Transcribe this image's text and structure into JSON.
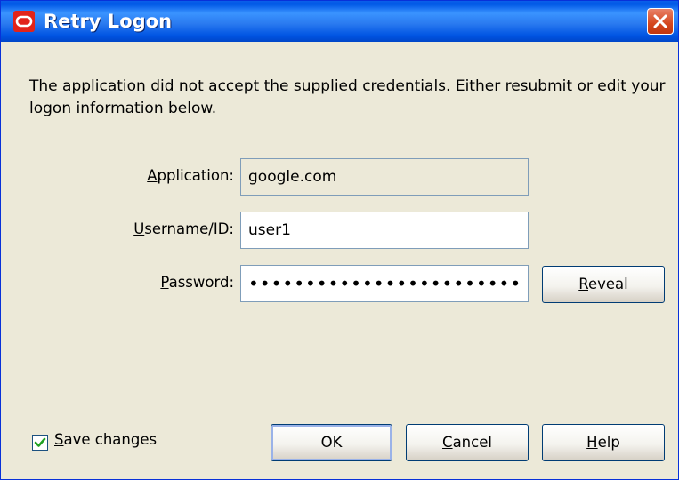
{
  "window": {
    "title": "Retry Logon"
  },
  "message": "The application did not accept the supplied credentials. Either resubmit or edit your logon information below.",
  "form": {
    "application": {
      "label_u": "A",
      "label_rest": "pplication:",
      "value": "google.com"
    },
    "username": {
      "label_u": "U",
      "label_rest": "sername/ID:",
      "value": "user1"
    },
    "password": {
      "label_u": "P",
      "label_rest": "assword:",
      "value": "••••••••••••••••••••••••"
    }
  },
  "buttons": {
    "reveal": {
      "u": "R",
      "rest": "eveal"
    },
    "ok": {
      "label": "OK"
    },
    "cancel": {
      "u": "C",
      "rest": "ancel"
    },
    "help": {
      "u": "H",
      "rest": "elp"
    }
  },
  "save_changes": {
    "u": "S",
    "rest": "ave changes",
    "checked": true
  },
  "colors": {
    "title_bar": "#0054E3",
    "dialog_bg": "#ECE9D8",
    "close_button": "#D5461D",
    "oracle_red": "#E2231A"
  }
}
